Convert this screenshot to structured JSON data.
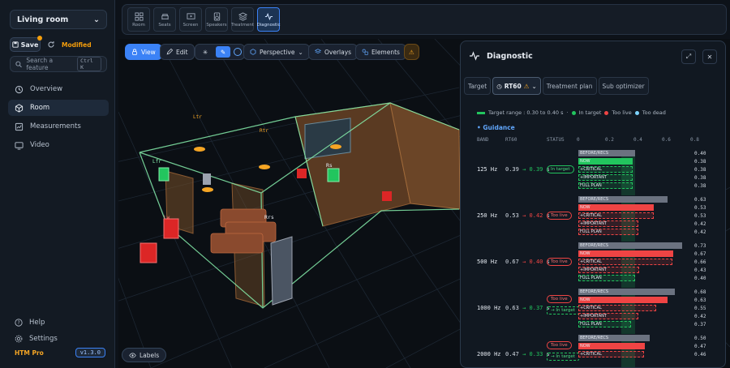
{
  "sidebar": {
    "room_select": "Living room",
    "save_label": "Save",
    "modified_label": "Modified",
    "search_placeholder": "Search a feature",
    "search_shortcut": "Ctrl K",
    "nav": [
      {
        "label": "Overview",
        "icon": "sparkle-icon"
      },
      {
        "label": "Room",
        "icon": "cube-icon"
      },
      {
        "label": "Measurements",
        "icon": "chart-icon"
      },
      {
        "label": "Video",
        "icon": "monitor-icon"
      }
    ],
    "help_label": "Help",
    "settings_label": "Settings",
    "plan": "HTM Pro",
    "version": "v1.3.0"
  },
  "toolbar": {
    "items": [
      {
        "label": "Room",
        "icon": "grid-icon"
      },
      {
        "label": "Seats",
        "icon": "sofa-icon"
      },
      {
        "label": "Screen",
        "icon": "screen-icon"
      },
      {
        "label": "Speakers",
        "icon": "speaker-icon"
      },
      {
        "label": "Treatment",
        "icon": "layers-icon"
      },
      {
        "label": "Diagnostic",
        "icon": "pulse-icon"
      }
    ],
    "active": "Diagnostic"
  },
  "viewport": {
    "view_label": "View",
    "edit_label": "Edit",
    "perspective_label": "Perspective",
    "overlays_label": "Overlays",
    "elements_label": "Elements",
    "labels_label": "Labels",
    "speaker_tags": [
      "Ltr",
      "Rtr",
      "Lfr",
      "Rrs",
      "Lw",
      "Rs"
    ]
  },
  "diagnostic": {
    "title": "Diagnostic",
    "tabs": [
      "Target",
      "RT60",
      "Treatment plan",
      "Sub optimizer"
    ],
    "active_tab": "RT60",
    "legend": {
      "range": "Target range : 0.30 to 0.40 s",
      "in_target": "In target",
      "too_live": "Too live",
      "too_dead": "Too dead"
    },
    "guidance_label": "• Guidance",
    "headers": {
      "band": "BAND",
      "rt60": "RT60",
      "status": "STATUS",
      "ticks": [
        "0",
        "0.2",
        "0.4",
        "0.6",
        "0.8"
      ]
    },
    "colors": {
      "in_target": "#22c55e",
      "too_live": "#ef4444",
      "too_dead": "#60a5fa",
      "before": "#6b7280"
    },
    "bands": [
      {
        "band": "125 Hz",
        "from": "0.39",
        "to": "0.39",
        "unit": "s",
        "to_state": "g",
        "statuses": [
          {
            "text": "In target",
            "kind": "green"
          }
        ],
        "rows": [
          {
            "label": "BEFORE/RECS",
            "value": 0.4,
            "text": "0.40",
            "kind": "before"
          },
          {
            "label": "NOW",
            "value": 0.38,
            "text": "0.38",
            "kind": "green"
          },
          {
            "label": "+CRITICAL",
            "value": 0.38,
            "text": "0.38",
            "kind": "green-dash"
          },
          {
            "label": "+IMPORTANT",
            "value": 0.38,
            "text": "0.38",
            "kind": "green-dash"
          },
          {
            "label": "FULL PLAN",
            "value": 0.38,
            "text": "0.38",
            "kind": "green-dash"
          }
        ]
      },
      {
        "band": "250 Hz",
        "from": "0.53",
        "to": "0.42",
        "unit": "s",
        "to_state": "r",
        "statuses": [
          {
            "text": "Too live",
            "kind": "red"
          }
        ],
        "rows": [
          {
            "label": "BEFORE/RECS",
            "value": 0.63,
            "text": "0.63",
            "kind": "before"
          },
          {
            "label": "NOW",
            "value": 0.53,
            "text": "0.53",
            "kind": "red"
          },
          {
            "label": "+CRITICAL",
            "value": 0.53,
            "text": "0.53",
            "kind": "red-dash"
          },
          {
            "label": "+IMPORTANT",
            "value": 0.42,
            "text": "0.42",
            "kind": "red-dash"
          },
          {
            "label": "FULL PLAN",
            "value": 0.42,
            "text": "0.42",
            "kind": "red-dash"
          }
        ]
      },
      {
        "band": "500 Hz",
        "from": "0.67",
        "to": "0.40",
        "unit": "s",
        "to_state": "r",
        "statuses": [
          {
            "text": "Too live",
            "kind": "red"
          }
        ],
        "rows": [
          {
            "label": "BEFORE/RECS",
            "value": 0.73,
            "text": "0.73",
            "kind": "before"
          },
          {
            "label": "NOW",
            "value": 0.67,
            "text": "0.67",
            "kind": "red"
          },
          {
            "label": "+CRITICAL",
            "value": 0.66,
            "text": "0.66",
            "kind": "red-dash"
          },
          {
            "label": "+IMPORTANT",
            "value": 0.43,
            "text": "0.43",
            "kind": "red-dash"
          },
          {
            "label": "FULL PLAN",
            "value": 0.4,
            "text": "0.40",
            "kind": "green-dash"
          }
        ]
      },
      {
        "band": "1000 Hz",
        "from": "0.63",
        "to": "0.37",
        "unit": "s",
        "to_state": "g",
        "statuses": [
          {
            "text": "Too live",
            "kind": "red"
          },
          {
            "text": "→ In target",
            "kind": "dash"
          }
        ],
        "rows": [
          {
            "label": "BEFORE/RECS",
            "value": 0.68,
            "text": "0.68",
            "kind": "before"
          },
          {
            "label": "NOW",
            "value": 0.63,
            "text": "0.63",
            "kind": "red"
          },
          {
            "label": "+CRITICAL",
            "value": 0.55,
            "text": "0.55",
            "kind": "red-dash"
          },
          {
            "label": "+IMPORTANT",
            "value": 0.42,
            "text": "0.42",
            "kind": "red-dash"
          },
          {
            "label": "FULL PLAN",
            "value": 0.37,
            "text": "0.37",
            "kind": "green-dash"
          }
        ]
      },
      {
        "band": "2000 Hz",
        "from": "0.47",
        "to": "0.33",
        "unit": "s",
        "to_state": "g",
        "statuses": [
          {
            "text": "Too live",
            "kind": "red"
          },
          {
            "text": "→ In target",
            "kind": "dash"
          }
        ],
        "rows": [
          {
            "label": "BEFORE/RECS",
            "value": 0.5,
            "text": "0.50",
            "kind": "before"
          },
          {
            "label": "NOW",
            "value": 0.47,
            "text": "0.47",
            "kind": "red"
          },
          {
            "label": "+CRITICAL",
            "value": 0.46,
            "text": "0.46",
            "kind": "red-dash"
          }
        ]
      }
    ]
  }
}
